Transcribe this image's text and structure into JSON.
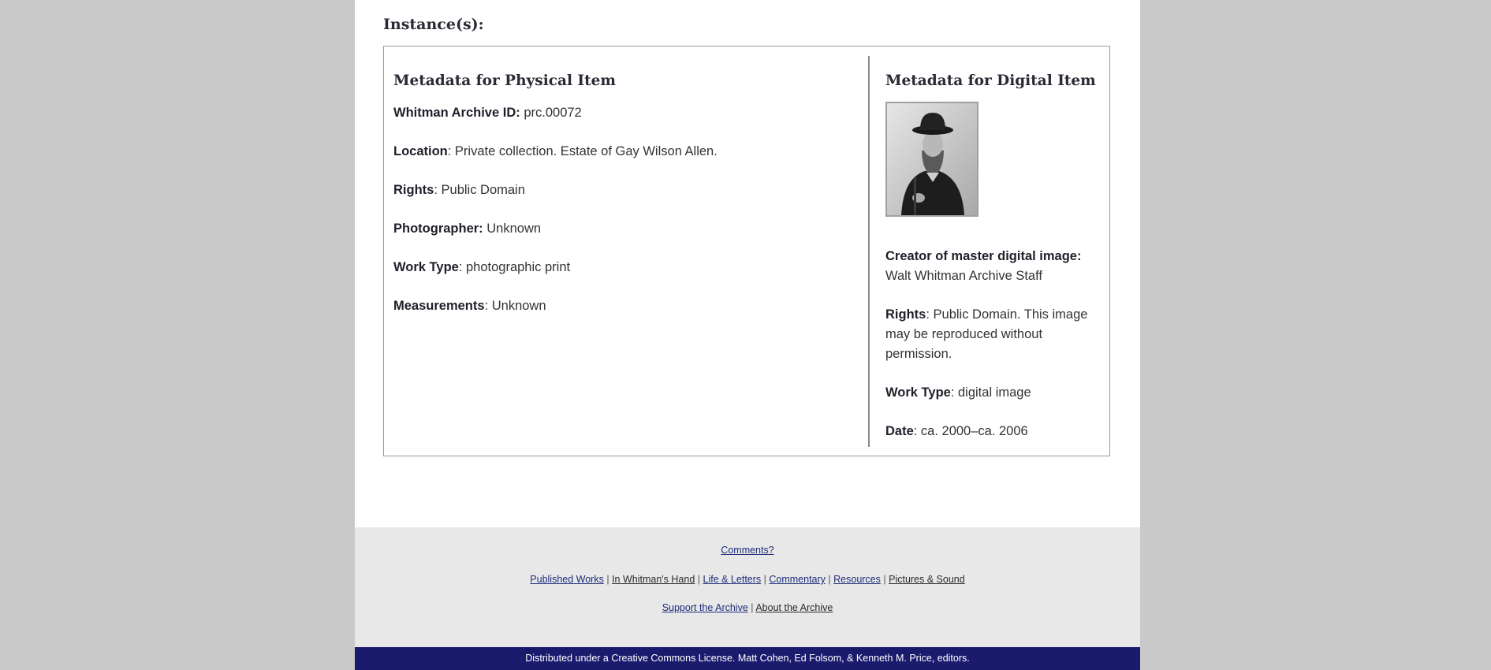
{
  "instances_heading": "Instance(s):",
  "physical": {
    "heading": "Metadata for Physical Item",
    "fields": [
      {
        "label": "Whitman Archive ID:",
        "value": "prc.00072"
      },
      {
        "label": "Location",
        "value": ": Private collection. Estate of Gay Wilson Allen."
      },
      {
        "label": "Rights",
        "value": ": Public Domain"
      },
      {
        "label": "Photographer:",
        "value": "Unknown"
      },
      {
        "label": "Work Type",
        "value": ": photographic print"
      },
      {
        "label": "Measurements",
        "value": ": Unknown"
      }
    ]
  },
  "digital": {
    "heading": "Metadata for Digital Item",
    "image_alt": "portrait photograph thumbnail",
    "fields": [
      {
        "label": "Creator of master digital image:",
        "value": "Walt Whitman Archive Staff"
      },
      {
        "label": "Rights",
        "value": ": Public Domain. This image may be reproduced without permission."
      },
      {
        "label": "Work Type",
        "value": ": digital image"
      },
      {
        "label": "Date",
        "value": ": ca. 2000–ca. 2006"
      }
    ]
  },
  "footer": {
    "comments": "Comments?",
    "nav": [
      "Published Works",
      "In Whitman's Hand",
      "Life & Letters",
      "Commentary",
      "Resources",
      "Pictures & Sound"
    ],
    "support": "Support the Archive",
    "about": "About the Archive",
    "separator": "|"
  },
  "license": {
    "prefix": "Distributed under a ",
    "link": "Creative Commons License",
    "suffix": ". Matt Cohen, Ed Folsom, & Kenneth M. Price, editors."
  },
  "colors": {
    "page_bg": "#c9c9c9",
    "footer_bg": "#e8e8e8",
    "license_bar": "#1b1b6e",
    "link": "#1e2d7a"
  }
}
